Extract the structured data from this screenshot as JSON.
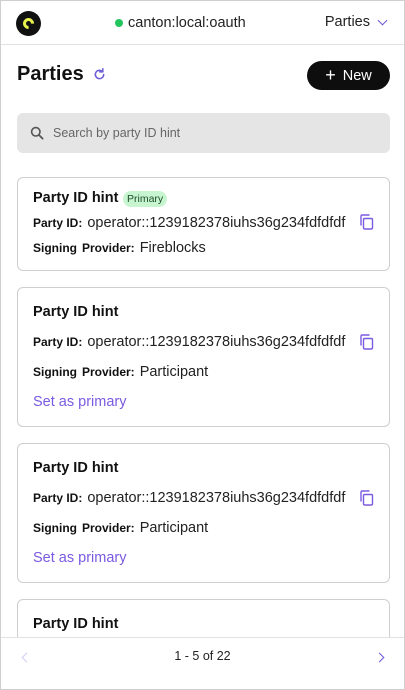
{
  "header": {
    "network_label": "canton:local:oauth",
    "network_status_color": "#22c55e",
    "nav_selected": "Parties"
  },
  "page": {
    "title": "Parties",
    "new_button_label": "New",
    "new_button_icon": "plus-icon",
    "refresh_icon": "refresh-icon"
  },
  "search": {
    "placeholder": "Search by party ID hint"
  },
  "labels": {
    "party_id": "Party ID:",
    "signing": "Signing",
    "provider": "Provider:",
    "set_primary": "Set as primary"
  },
  "cards": [
    {
      "title": "Party ID hint",
      "badge": "Primary",
      "party_id": "operator::1239182378iuhs36g234fdfdfdf",
      "signing_provider": "Fireblocks"
    },
    {
      "title": "Party ID hint",
      "party_id": "operator::1239182378iuhs36g234fdfdfdf",
      "signing_provider": "Participant"
    },
    {
      "title": "Party ID hint",
      "party_id": "operator::1239182378iuhs36g234fdfdfdf",
      "signing_provider": "Participant"
    },
    {
      "title": "Party ID hint"
    }
  ],
  "pagination": {
    "text": "1 - 5 of 22"
  },
  "colors": {
    "accent": "#7a5ae0",
    "primary_badge_bg": "#c7f5cf",
    "button_bg": "#0e0e0e",
    "logo_yellow": "#e9f24c"
  }
}
